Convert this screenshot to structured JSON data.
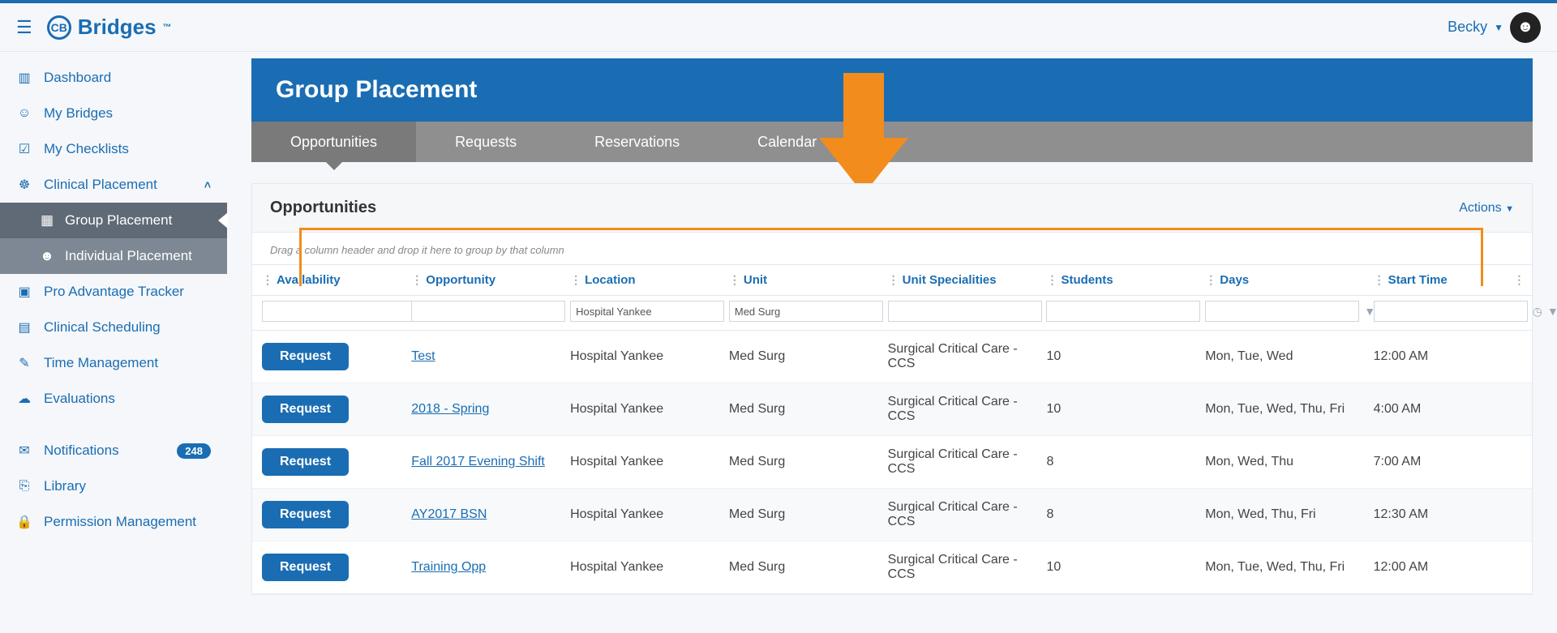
{
  "brand": {
    "name": "Bridges",
    "tm": "™",
    "logo_letters": "CB"
  },
  "user": {
    "name": "Becky"
  },
  "sidebar": {
    "items": [
      {
        "icon": "bar-chart-icon",
        "glyph": "▥",
        "label": "Dashboard"
      },
      {
        "icon": "users-icon",
        "glyph": "☺",
        "label": "My Bridges"
      },
      {
        "icon": "checkbox-icon",
        "glyph": "☑",
        "label": "My Checklists"
      }
    ],
    "clinical": {
      "icon": "user-plus-icon",
      "glyph": "☸",
      "label": "Clinical Placement",
      "children": [
        {
          "icon": "group-icon",
          "glyph": "▦",
          "label": "Group Placement",
          "active": true
        },
        {
          "icon": "person-icon",
          "glyph": "☻",
          "label": "Individual Placement",
          "active": false
        }
      ]
    },
    "more": [
      {
        "icon": "map-icon",
        "glyph": "▣",
        "label": "Pro Advantage Tracker"
      },
      {
        "icon": "calendar-icon",
        "glyph": "▤",
        "label": "Clinical Scheduling"
      },
      {
        "icon": "edit-icon",
        "glyph": "✎",
        "label": "Time Management"
      },
      {
        "icon": "chat-icon",
        "glyph": "☁",
        "label": "Evaluations"
      }
    ],
    "bottom": [
      {
        "icon": "envelope-icon",
        "glyph": "✉",
        "label": "Notifications",
        "badge": "248"
      },
      {
        "icon": "copy-icon",
        "glyph": "⎘",
        "label": "Library"
      },
      {
        "icon": "lock-icon",
        "glyph": "🔒",
        "label": "Permission Management"
      }
    ]
  },
  "page": {
    "title": "Group Placement",
    "tabs": [
      "Opportunities",
      "Requests",
      "Reservations",
      "Calendar"
    ],
    "active_tab": 0
  },
  "panel": {
    "title": "Opportunities",
    "actions_label": "Actions",
    "groupby_hint": "Drag a column header and drop it here to group by that column"
  },
  "columns": [
    "Availability",
    "Opportunity",
    "Location",
    "Unit",
    "Unit Specialities",
    "Students",
    "Days",
    "Start Time"
  ],
  "filters": {
    "location": "Hospital Yankee",
    "unit": "Med Surg"
  },
  "button_label": "Request",
  "rows": [
    {
      "opportunity": "Test",
      "location": "Hospital Yankee",
      "unit": "Med Surg",
      "spec": "Surgical Critical Care - CCS",
      "students": "10",
      "days": "Mon, Tue, Wed",
      "start": "12:00 AM"
    },
    {
      "opportunity": "2018 - Spring",
      "location": "Hospital Yankee",
      "unit": "Med Surg",
      "spec": "Surgical Critical Care - CCS",
      "students": "10",
      "days": "Mon, Tue, Wed, Thu, Fri",
      "start": "4:00 AM"
    },
    {
      "opportunity": "Fall 2017 Evening Shift",
      "location": "Hospital Yankee",
      "unit": "Med Surg",
      "spec": "Surgical Critical Care - CCS",
      "students": "8",
      "days": "Mon, Wed, Thu",
      "start": "7:00 AM"
    },
    {
      "opportunity": "AY2017 BSN",
      "location": "Hospital Yankee",
      "unit": "Med Surg",
      "spec": "Surgical Critical Care - CCS",
      "students": "8",
      "days": "Mon, Wed, Thu, Fri",
      "start": "12:30 AM"
    },
    {
      "opportunity": "Training Opp",
      "location": "Hospital Yankee",
      "unit": "Med Surg",
      "spec": "Surgical Critical Care - CCS",
      "students": "10",
      "days": "Mon, Tue, Wed, Thu, Fri",
      "start": "12:00 AM"
    }
  ],
  "annotation": {
    "color": "#f28c1c"
  }
}
